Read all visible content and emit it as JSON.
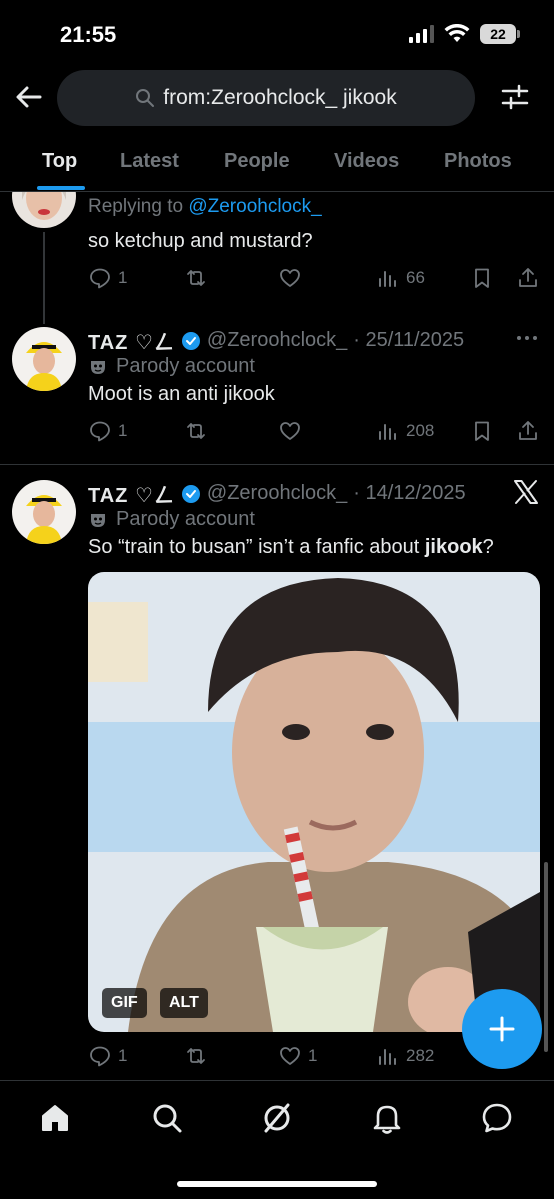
{
  "status_bar": {
    "time": "21:55",
    "battery": "22"
  },
  "search": {
    "query": "from:Zeroohclock_ jikook"
  },
  "tabs": [
    "Top",
    "Latest",
    "People",
    "Videos",
    "Photos"
  ],
  "reply": {
    "replying_to_prefix": "Replying to",
    "replying_to_handle": "@Zeroohclock_",
    "text": "so ketchup and mustard?",
    "replies": "1",
    "likes": "",
    "views": "66"
  },
  "tweet1": {
    "name": "TAZ ♡ㄥ",
    "handle": "@Zeroohclock_",
    "date": "· 25/11/2025",
    "label": "Parody account",
    "text": "Moot is an anti jikook",
    "replies": "1",
    "views": "208"
  },
  "tweet2": {
    "name": "TAZ ♡ㄥ",
    "handle": "@Zeroohclock_",
    "date": "· 14/12/2025",
    "label": "Parody account",
    "text_before": "So “train to busan” isn’t a fanfic about ",
    "text_bold": "jikook",
    "text_after": "?",
    "media_badges": {
      "gif": "GIF",
      "alt": "ALT"
    },
    "replies": "1",
    "likes": "1",
    "views": "282"
  },
  "colors": {
    "accent": "#1d9bf0",
    "muted": "#71767b",
    "background": "#000000"
  },
  "icons": [
    "back-arrow-icon",
    "search-icon",
    "filter-sliders-icon",
    "reply-icon",
    "retweet-icon",
    "like-icon",
    "views-icon",
    "bookmark-icon",
    "share-icon",
    "verified-badge-icon",
    "parody-mask-icon",
    "x-logo-icon",
    "plus-icon",
    "home-icon",
    "explore-icon",
    "grok-icon",
    "notifications-icon",
    "messages-icon"
  ]
}
